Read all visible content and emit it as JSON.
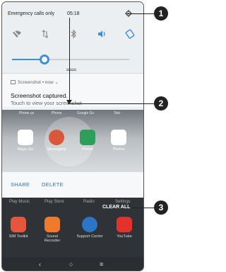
{
  "status_bar": {
    "carrier_text": "Emergency calls only",
    "time": "05:18",
    "settings_icon": "gear-icon"
  },
  "quick_tiles": [
    {
      "icon": "wifi-off-icon",
      "active": false
    },
    {
      "icon": "mobile-data-icon",
      "active": false
    },
    {
      "icon": "bluetooth-icon",
      "active": false
    },
    {
      "icon": "sound-icon",
      "active": true
    },
    {
      "icon": "auto-rotate-icon",
      "active": true
    }
  ],
  "brightness": {
    "level": 0.28
  },
  "notification": {
    "app": "Screenshot",
    "time": "now",
    "title": "Screenshot captured.",
    "body": "Touch to view your screenshot"
  },
  "preview": {
    "top_labels": [
      "Phone us",
      "Phone",
      "Google Go",
      "Tele"
    ],
    "apps": [
      {
        "label": "Maps Go",
        "color": "#ffffff"
      },
      {
        "label": "Messaging",
        "color": "#d9583b"
      },
      {
        "label": "Phone",
        "color": "#2e9e5b"
      },
      {
        "label": "Photos",
        "color": "#ffffff"
      }
    ]
  },
  "actions": {
    "share": "SHARE",
    "delete": "DELETE"
  },
  "recents": {
    "top_labels": [
      "Play Music",
      "Play Store",
      "Radio",
      "Settings"
    ],
    "clear_all": "CLEAR ALL",
    "dock": [
      {
        "label": "SIM Toolkit",
        "color": "#e4573c"
      },
      {
        "label": "Sound Recorder",
        "color": "#ef7a2c"
      },
      {
        "label": "Support Center",
        "color": "#2c74c4"
      },
      {
        "label": "YouTube",
        "color": "#e3322b"
      }
    ]
  },
  "navbar": {
    "back": "‹",
    "home": "○",
    "recents": "≡"
  },
  "callouts": [
    "1",
    "2",
    "3"
  ],
  "colors": {
    "accent": "#3a8fe0",
    "button": "#2d6fb7"
  }
}
